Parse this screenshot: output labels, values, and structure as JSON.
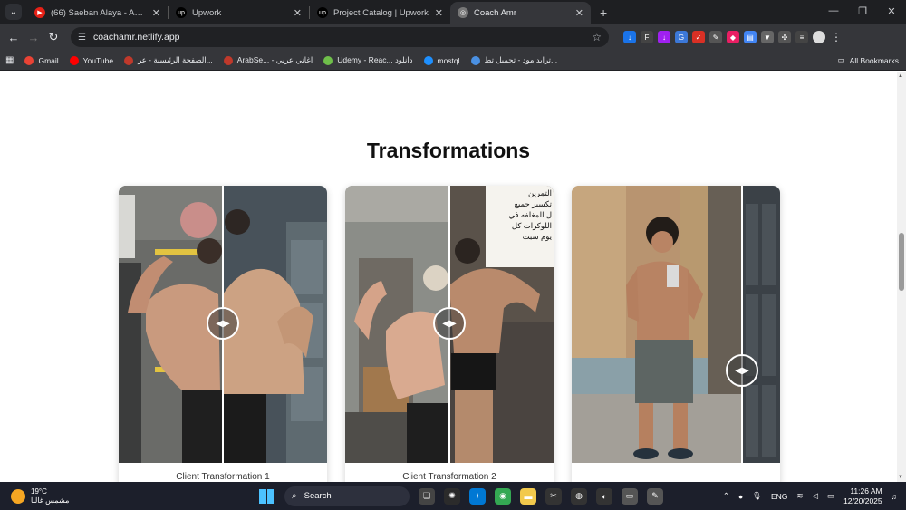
{
  "browser": {
    "tabs": [
      {
        "title": "(66) Saeban Alaya - Amr Diab ...",
        "icon": "youtube-icon",
        "color": "#e62117",
        "active": false
      },
      {
        "title": "Upwork",
        "icon": "upwork-icon",
        "color": "#222",
        "active": false
      },
      {
        "title": "Project Catalog | Upwork",
        "icon": "upwork-icon",
        "color": "#222",
        "active": false
      },
      {
        "title": "Coach Amr",
        "icon": "globe-icon",
        "color": "#666",
        "active": true
      }
    ],
    "url": "coachamr.netlify.app",
    "bookmarks": [
      {
        "label": "Gmail",
        "color": "#ea4335"
      },
      {
        "label": "YouTube",
        "color": "#ff0000"
      },
      {
        "label": "الصفحة الرئيسية - عر...",
        "color": "#c0392b"
      },
      {
        "label": "ArabSe... - اغاني عربي",
        "color": "#c0392b"
      },
      {
        "label": "Udemy - Reac... دانلود",
        "color": "#6fbf4a"
      },
      {
        "label": "mostql",
        "color": "#1e90ff"
      },
      {
        "label": "ترايد مود - تحميل تط...",
        "color": "#4a90e2"
      }
    ],
    "all_bookmarks": "All Bookmarks"
  },
  "page": {
    "section_title": "Transformations",
    "cards": [
      {
        "caption": "Client Transformation 1",
        "left_bg": "#6e6f6c",
        "right_bg": "#4b5457",
        "divider_pct": 49.5
      },
      {
        "caption": "Client Transformation 2",
        "left_bg": "#8a8c88",
        "right_bg": "#5c554e",
        "divider_pct": 49.5
      },
      {
        "caption": "",
        "left_bg": "#b79a77",
        "right_bg": "#3c4246",
        "divider_pct": 82
      }
    ],
    "sign_text": [
      "التمرين",
      "تكسير جميع",
      "ل المغلفه في",
      "اللوكرات كل",
      "يوم سبت"
    ]
  },
  "taskbar": {
    "temperature": "19°C",
    "weather_label": "مشمس غالبا",
    "search_label": "Search",
    "language": "ENG",
    "time": "11:26 AM",
    "date": "12/20/2025"
  }
}
